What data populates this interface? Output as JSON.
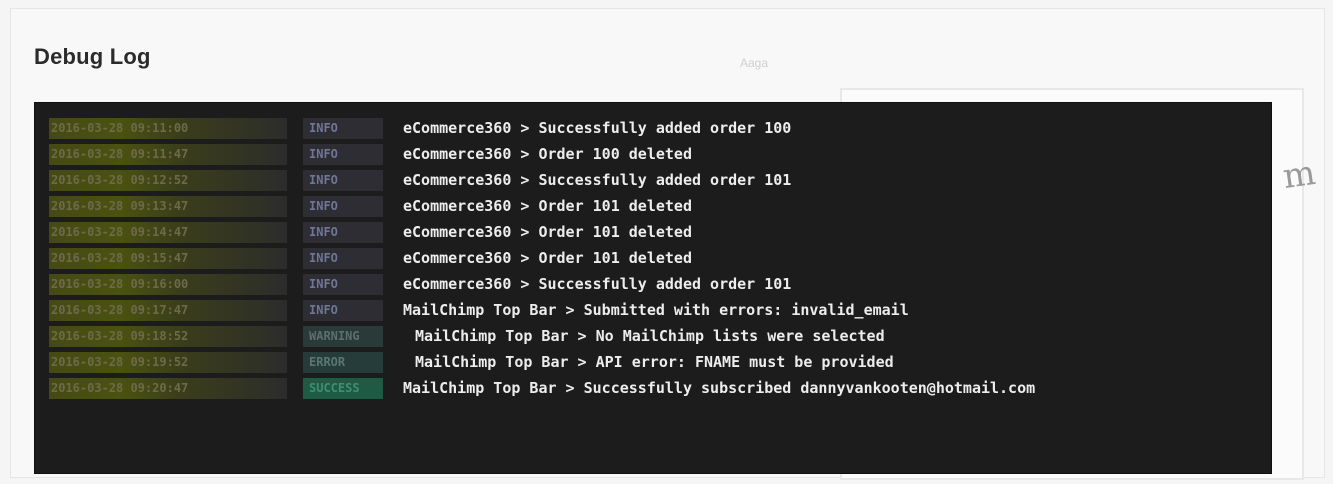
{
  "panel": {
    "title": "Debug Log"
  },
  "background": {
    "faint_label": "Aaga",
    "side_glyph": "m"
  },
  "colors": {
    "console_background": "#1c1c1c",
    "timestamp_highlight": "#4a5210",
    "success_level": "#1f5a45",
    "message_text": "#ededed"
  },
  "log": {
    "entries": [
      {
        "timestamp": "2016-03-28 09:11:00",
        "level": "INFO",
        "message": "eCommerce360 > Successfully added order 100"
      },
      {
        "timestamp": "2016-03-28 09:11:47",
        "level": "INFO",
        "message": "eCommerce360 > Order 100 deleted"
      },
      {
        "timestamp": "2016-03-28 09:12:52",
        "level": "INFO",
        "message": "eCommerce360 > Successfully added order 101"
      },
      {
        "timestamp": "2016-03-28 09:13:47",
        "level": "INFO",
        "message": "eCommerce360 > Order 101 deleted"
      },
      {
        "timestamp": "2016-03-28 09:14:47",
        "level": "INFO",
        "message": "eCommerce360 > Order 101 deleted"
      },
      {
        "timestamp": "2016-03-28 09:15:47",
        "level": "INFO",
        "message": "eCommerce360 > Order 101 deleted"
      },
      {
        "timestamp": "2016-03-28 09:16:00",
        "level": "INFO",
        "message": "eCommerce360 > Successfully added order 101"
      },
      {
        "timestamp": "2016-03-28 09:17:47",
        "level": "INFO",
        "message": "MailChimp Top Bar > Submitted with errors: invalid_email"
      },
      {
        "timestamp": "2016-03-28 09:18:52",
        "level": "WARNING",
        "message": "MailChimp Top Bar > No MailChimp lists were selected"
      },
      {
        "timestamp": "2016-03-28 09:19:52",
        "level": "ERROR",
        "message": "MailChimp Top Bar > API error: FNAME must be provided"
      },
      {
        "timestamp": "2016-03-28 09:20:47",
        "level": "SUCCESS",
        "message": "MailChimp Top Bar > Successfully subscribed dannyvankooten@hotmail.com"
      }
    ]
  }
}
